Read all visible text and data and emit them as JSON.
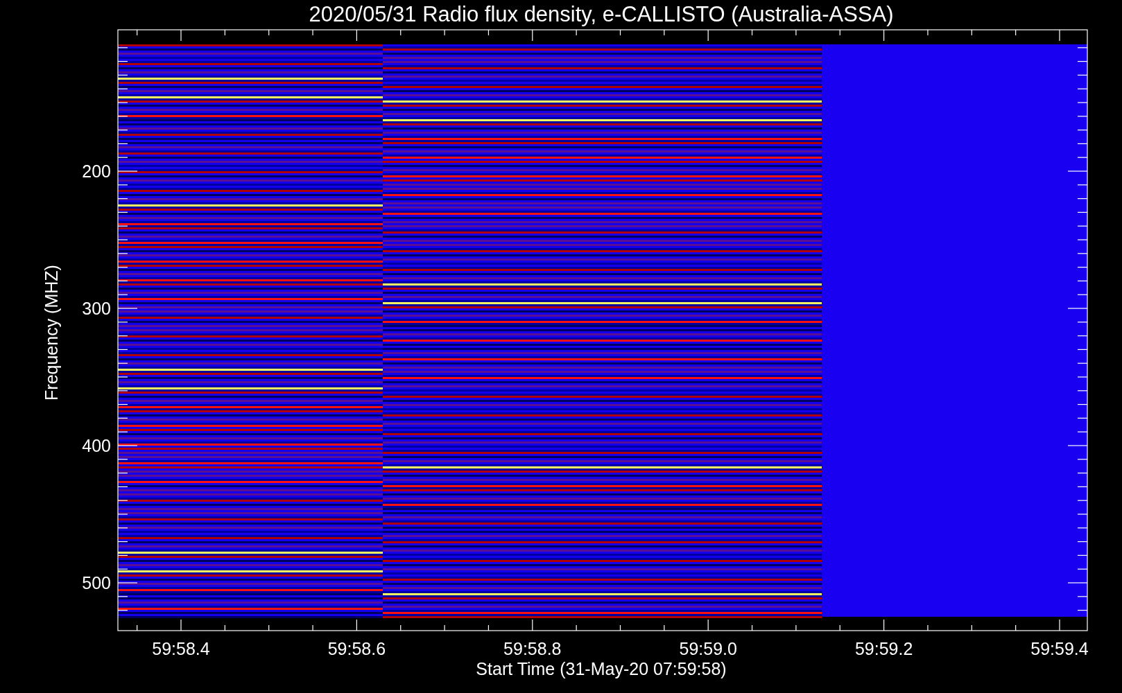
{
  "title": "2020/05/31  Radio flux density, e-CALLISTO (Australia-ASSA)",
  "plot": {
    "ylabel": "Frequency (MHZ)",
    "xlabel": "Start Time (31-May-20 07:59:58)",
    "yticks": [
      "200",
      "300",
      "400",
      "500"
    ],
    "xticks": [
      "59:58.4",
      "59:58.6",
      "59:58.8",
      "59:59.0",
      "59:59.2",
      "59:59.4"
    ]
  }
}
